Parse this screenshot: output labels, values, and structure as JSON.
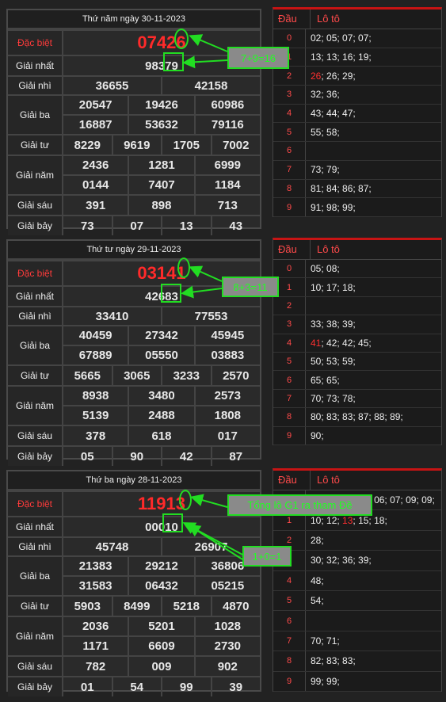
{
  "draws": [
    {
      "date": "Thứ năm ngày 30-11-2023",
      "rows": [
        {
          "label": "Đặc biệt",
          "lines": [
            [
              "07426"
            ]
          ]
        },
        {
          "label": "Giải nhất",
          "lines": [
            [
              "98379"
            ]
          ]
        },
        {
          "label": "Giải nhì",
          "lines": [
            [
              "36655",
              "42158"
            ]
          ]
        },
        {
          "label": "Giải ba",
          "lines": [
            [
              "20547",
              "19426",
              "60986"
            ],
            [
              "16887",
              "53632",
              "79116"
            ]
          ]
        },
        {
          "label": "Giải tư",
          "lines": [
            [
              "8229",
              "9619",
              "1705",
              "7002"
            ]
          ]
        },
        {
          "label": "Giải năm",
          "lines": [
            [
              "2436",
              "1281",
              "6999"
            ],
            [
              "0144",
              "7407",
              "1184"
            ]
          ]
        },
        {
          "label": "Giải sáu",
          "lines": [
            [
              "391",
              "898",
              "713"
            ]
          ]
        },
        {
          "label": "Giải bảy",
          "lines": [
            [
              "73",
              "07",
              "13",
              "43"
            ]
          ]
        }
      ],
      "loto": {
        "head_dau": "Đầu",
        "head_loto": "Lô tô",
        "rows": [
          {
            "d": "0",
            "nums": "02; 05; 07; 07;"
          },
          {
            "d": "1",
            "nums": "13; 13; 16; 19;"
          },
          {
            "d": "2",
            "red": "26",
            "nums": "; 26; 29;"
          },
          {
            "d": "3",
            "nums": "32; 36;"
          },
          {
            "d": "4",
            "nums": "43; 44; 47;"
          },
          {
            "d": "5",
            "nums": "55; 58;"
          },
          {
            "d": "6",
            "nums": ""
          },
          {
            "d": "7",
            "nums": "73; 79;"
          },
          {
            "d": "8",
            "nums": "81; 84; 86; 87;"
          },
          {
            "d": "9",
            "nums": "91; 98; 99;"
          }
        ]
      },
      "annotation": "7+9=16"
    },
    {
      "date": "Thứ tư ngày 29-11-2023",
      "rows": [
        {
          "label": "Đặc biệt",
          "lines": [
            [
              "03141"
            ]
          ]
        },
        {
          "label": "Giải nhất",
          "lines": [
            [
              "42683"
            ]
          ]
        },
        {
          "label": "Giải nhì",
          "lines": [
            [
              "33410",
              "77553"
            ]
          ]
        },
        {
          "label": "Giải ba",
          "lines": [
            [
              "40459",
              "27342",
              "45945"
            ],
            [
              "67889",
              "05550",
              "03883"
            ]
          ]
        },
        {
          "label": "Giải tư",
          "lines": [
            [
              "5665",
              "3065",
              "3233",
              "2570"
            ]
          ]
        },
        {
          "label": "Giải năm",
          "lines": [
            [
              "8938",
              "3480",
              "2573"
            ],
            [
              "5139",
              "2488",
              "1808"
            ]
          ]
        },
        {
          "label": "Giải sáu",
          "lines": [
            [
              "378",
              "618",
              "017"
            ]
          ]
        },
        {
          "label": "Giải bảy",
          "lines": [
            [
              "05",
              "90",
              "42",
              "87"
            ]
          ]
        }
      ],
      "loto": {
        "head_dau": "Đầu",
        "head_loto": "Lô tô",
        "rows": [
          {
            "d": "0",
            "nums": "05; 08;"
          },
          {
            "d": "1",
            "nums": "10; 17; 18;"
          },
          {
            "d": "2",
            "nums": ""
          },
          {
            "d": "3",
            "nums": "33; 38; 39;"
          },
          {
            "d": "4",
            "red": "41",
            "nums": "; 42; 42; 45;"
          },
          {
            "d": "5",
            "nums": "50; 53; 59;"
          },
          {
            "d": "6",
            "nums": "65; 65;"
          },
          {
            "d": "7",
            "nums": "70; 73; 78;"
          },
          {
            "d": "8",
            "nums": "80; 83; 83; 87; 88; 89;"
          },
          {
            "d": "9",
            "nums": "90;"
          }
        ]
      },
      "annotation": "8+3=11"
    },
    {
      "date": "Thứ ba ngày 28-11-2023",
      "rows": [
        {
          "label": "Đặc biệt",
          "lines": [
            [
              "11913"
            ]
          ]
        },
        {
          "label": "Giải nhất",
          "lines": [
            [
              "00010"
            ]
          ]
        },
        {
          "label": "Giải nhì",
          "lines": [
            [
              "45748",
              "26907"
            ]
          ]
        },
        {
          "label": "Giải ba",
          "lines": [
            [
              "21383",
              "29212",
              "36806"
            ],
            [
              "31583",
              "06432",
              "05215"
            ]
          ]
        },
        {
          "label": "Giải tư",
          "lines": [
            [
              "5903",
              "8499",
              "5218",
              "4870"
            ]
          ]
        },
        {
          "label": "Giải năm",
          "lines": [
            [
              "2036",
              "5201",
              "1028"
            ],
            [
              "1171",
              "6609",
              "2730"
            ]
          ]
        },
        {
          "label": "Giải sáu",
          "lines": [
            [
              "782",
              "009",
              "902"
            ]
          ]
        },
        {
          "label": "Giải bảy",
          "lines": [
            [
              "01",
              "54",
              "99",
              "39"
            ]
          ]
        }
      ],
      "loto": {
        "head_dau": "Đầu",
        "head_loto": "Lô tô",
        "rows": [
          {
            "d": "0",
            "nums": "01; 01; 02; 03; 06; 07; 09; 09;"
          },
          {
            "d": "1",
            "nums": "10; 12; ",
            "red": "13",
            "after": "; 15; 18;"
          },
          {
            "d": "2",
            "nums": "28;"
          },
          {
            "d": "3",
            "nums": "30; 32; 36; 39;"
          },
          {
            "d": "4",
            "nums": "48;"
          },
          {
            "d": "5",
            "nums": "54;"
          },
          {
            "d": "6",
            "nums": ""
          },
          {
            "d": "7",
            "nums": "70; 71;"
          },
          {
            "d": "8",
            "nums": "82; 83; 83;"
          },
          {
            "d": "9",
            "nums": "99; 99;"
          }
        ]
      },
      "annotation": "1+0=1",
      "annotation2": "Tổng lô G1 ra tham Đề"
    }
  ],
  "colors": {
    "accent_red": "#ff2a2a",
    "annotation_green": "#22dd22"
  }
}
